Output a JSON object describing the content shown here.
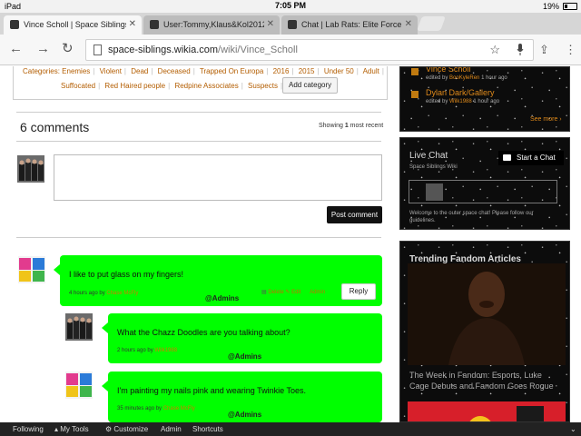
{
  "statusbar": {
    "device": "iPad",
    "time": "7:05 PM",
    "battery": "19%"
  },
  "tabs": [
    {
      "title": "Vince Scholl | Space Siblings",
      "active": true
    },
    {
      "title": "User:Tommy,Klaus&Kol2012",
      "active": false
    },
    {
      "title": "Chat | Lab Rats: Elite Force",
      "active": false
    }
  ],
  "toolbar": {
    "url_domain": "space-siblings.wikia.com",
    "url_path": "/wiki/Vince_Scholl"
  },
  "categories": {
    "label": "Categories:",
    "line1": [
      "Enemies",
      "Violent",
      "Dead",
      "Deceased",
      "Trapped On Europa",
      "2016",
      "2015",
      "Under 50",
      "Adult"
    ],
    "line2": [
      "Suffocated",
      "Red Haired people",
      "Redpine Associates",
      "Suspects"
    ],
    "add_button": "Add category"
  },
  "comments": {
    "title": "6 comments",
    "showing_prefix": "Showing",
    "showing_count": "1",
    "showing_suffix": "most recent",
    "post_button": "Post comment",
    "items": [
      {
        "text": "I like to put glass on my fingers!",
        "meta_prefix": "4 hours ago by",
        "user": "Chase McFly",
        "badge": "@Admins",
        "actions": [
          "Delete",
          "Edit",
          "Admin"
        ],
        "reply": "Reply"
      },
      {
        "text": "What the Chazz Doodles are you talking about?",
        "meta_prefix": "2 hours ago by",
        "user": "Wilk1988",
        "badge": "@Admins"
      },
      {
        "text": "I'm painting my nails pink and wearing Twinkie Toes.",
        "meta_prefix": "35 minutes ago by",
        "user": "Chase McFly",
        "badge": "@Admins"
      }
    ]
  },
  "rail": {
    "activity": [
      {
        "title": "Vince Scholl",
        "prefix": "edited by",
        "user": "BooKyleRen",
        "suffix": "1 hour ago"
      },
      {
        "title": "Dylan Dark/Gallery",
        "prefix": "edited by",
        "user": "Wilk1988",
        "suffix": "1 hour ago"
      }
    ],
    "see_more": "See more ›",
    "live_chat_title": "Live Chat",
    "chat_subtitle": "Space Siblings Wiki",
    "start_chat": "Start a Chat",
    "chat_welcome_line1": "Welcome to the outer space chat! Please follow our",
    "chat_welcome_line2": "guidelines.",
    "trending_title": "Trending Fandom Articles",
    "trending_caption_line1": "The Week in Fandom: Esports, Luke",
    "trending_caption_line2": "Cage Debuts and Fandom Goes Rogue"
  },
  "bottombar": {
    "following": "Following",
    "my_tools": "My Tools",
    "customize": "Customize",
    "admin": "Admin",
    "shortcuts": "Shortcuts"
  }
}
